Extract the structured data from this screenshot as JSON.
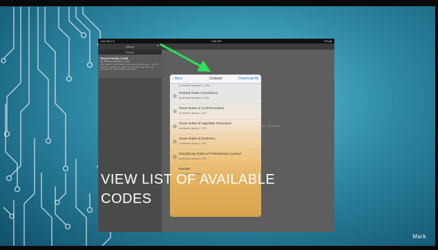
{
  "slide": {
    "caption_line1": "VIEW LIST OF AVAILABLE",
    "caption_line2": "CODES",
    "author": "Mark"
  },
  "status_bar": {
    "carrier": "Not Sent ✈",
    "time": "2:50 PM",
    "battery": "79% ■"
  },
  "sidebar": {
    "title": "Library",
    "search_label": "Search",
    "add_icon": "plus-icon",
    "item": {
      "title": "Texas Family Code",
      "subtitle": "As affirmed January 1, 2017",
      "description": "Best practices and selections throughout 2 data base — FIPS — Effective September 1, 2017 Texas Family Code 2017 rule amendments. Texas Family Code 2017"
    }
  },
  "main": {
    "placeholder": "NO LIBRARY CONTENT"
  },
  "modal": {
    "back_label": "Back",
    "title": "Codeset",
    "download_all_label": "Download All",
    "partial_top_date": "As effective September 1, 2016",
    "codes": [
      {
        "title": "Federal Rules of Evidence",
        "date": "As effective December 1, 2016"
      },
      {
        "title": "Texas Rules of Civil Procedure",
        "date": "As effective January 1, 2017"
      },
      {
        "title": "Texas Rules of Appellate Procedure",
        "date": "As effective January 1, 2017"
      },
      {
        "title": "Texas Rules of Evidence",
        "date": "As effective January 1, 2017"
      },
      {
        "title": "Disciplinary Rules of Professional Conduct",
        "date": "As effective January 1, 2017"
      }
    ],
    "partial_bottom_title": "PACER",
    "partial_bottom_date": "Code of Federal Rules"
  },
  "colors": {
    "arrow": "#2ee05a",
    "accent_blue": "#2e73d8",
    "background": "#2f8aa6"
  }
}
